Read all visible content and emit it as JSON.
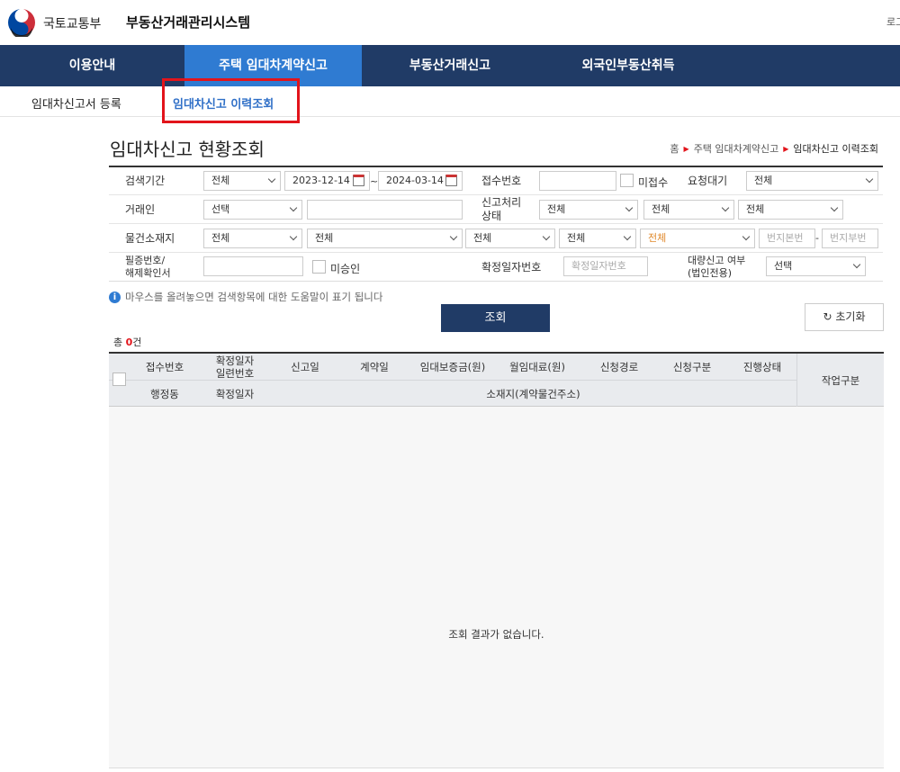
{
  "header": {
    "ministry": "국토교통부",
    "system_title": "부동산거래관리시스템",
    "login": "로그"
  },
  "gnb": [
    "이용안내",
    "주택 임대차계약신고",
    "부동산거래신고",
    "외국인부동산취득"
  ],
  "lnb": [
    "임대차신고서 등록",
    "임대차신고 이력조회"
  ],
  "page_title": "임대차신고 현황조회",
  "breadcrumb": [
    "홈",
    "주택 임대차계약신고",
    "임대차신고 이력조회"
  ],
  "form": {
    "period_label": "검색기간",
    "period_select": "전체",
    "date_from": "2023-12-14",
    "tilde": "~",
    "date_to": "2024-03-14",
    "receipt_label": "접수번호",
    "unreceived_label": "미접수",
    "wait_label": "요청대기",
    "wait_select": "전체",
    "trader_label": "거래인",
    "trader_select": "선택",
    "process_label_1": "신고처리",
    "process_label_2": "상태",
    "process_select_1": "전체",
    "process_select_2": "전체",
    "process_select_3": "전체",
    "location_label": "물건소재지",
    "loc_1": "전체",
    "loc_2": "전체",
    "loc_3": "전체",
    "loc_4": "전체",
    "loc_5": "전체",
    "main_num_placeholder": "번지본번",
    "dash": "-",
    "sub_num_placeholder": "번지부번",
    "cert_label_1": "필증번호/",
    "cert_label_2": "해제확인서",
    "unapproved_label": "미승인",
    "confirm_label": "확정일자번호",
    "confirm_placeholder": "확정일자번호",
    "bulk_label_1": "대량신고 여부",
    "bulk_label_2": "(법인전용)",
    "bulk_select": "선택"
  },
  "help_text": "마우스를 올려놓으면 검색항목에 대한 도움말이 표기 됩니다",
  "search_button": "조회",
  "reset_button": "초기화",
  "total_prefix": "총 ",
  "total_count": "0",
  "total_suffix": "건",
  "table": {
    "row1": [
      "접수번호",
      "확정일자",
      "일련번호",
      "신고일",
      "계약일",
      "임대보증금(원)",
      "월임대료(원)",
      "신청경로",
      "신청구분",
      "진행상태"
    ],
    "row2": [
      "행정동",
      "확정일자",
      "소재지(계약물건주소)"
    ],
    "work": "작업구분",
    "empty": "조회 결과가 없습니다."
  },
  "colors": {
    "navy": "#203b66",
    "active_tab": "#2f7bd2",
    "highlight_red": "#e2141b"
  }
}
